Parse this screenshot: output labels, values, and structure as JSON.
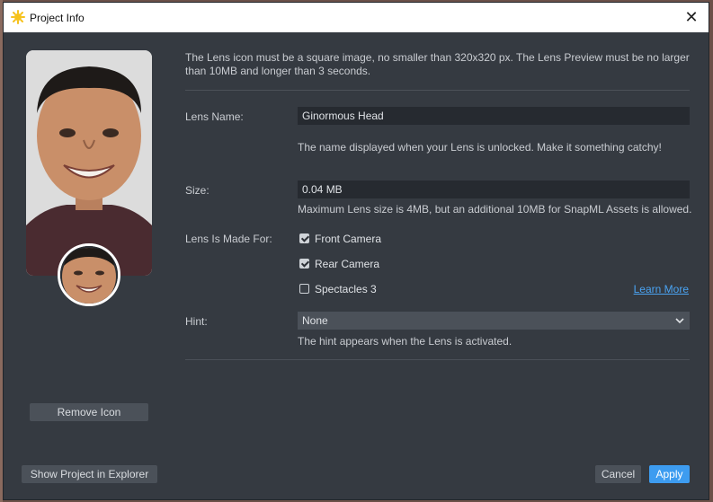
{
  "window": {
    "title": "Project Info",
    "close_glyph": "✕"
  },
  "info_text": "The Lens icon must be a square image, no smaller than 320x320 px. The Lens Preview must be no larger than 10MB and longer than 3 seconds.",
  "lens_name": {
    "label": "Lens Name:",
    "value": "Ginormous Head",
    "help": "The name displayed when your Lens is unlocked. Make it something catchy!"
  },
  "size": {
    "label": "Size:",
    "value": "0.04 MB",
    "help": "Maximum Lens size is 4MB, but an additional 10MB for SnapML Assets is allowed."
  },
  "made_for": {
    "label": "Lens Is Made For:",
    "options": [
      {
        "label": "Front Camera",
        "checked": true
      },
      {
        "label": "Rear Camera",
        "checked": true
      },
      {
        "label": "Spectacles 3",
        "checked": false
      }
    ],
    "learn_more": "Learn More"
  },
  "hint": {
    "label": "Hint:",
    "value": "None",
    "help": "The hint appears when the Lens is activated."
  },
  "buttons": {
    "remove_icon": "Remove Icon",
    "show_project": "Show Project in Explorer",
    "cancel": "Cancel",
    "apply": "Apply"
  },
  "colors": {
    "accent": "#3d9cf0",
    "link": "#4aa3f2",
    "panel": "#353a41"
  }
}
